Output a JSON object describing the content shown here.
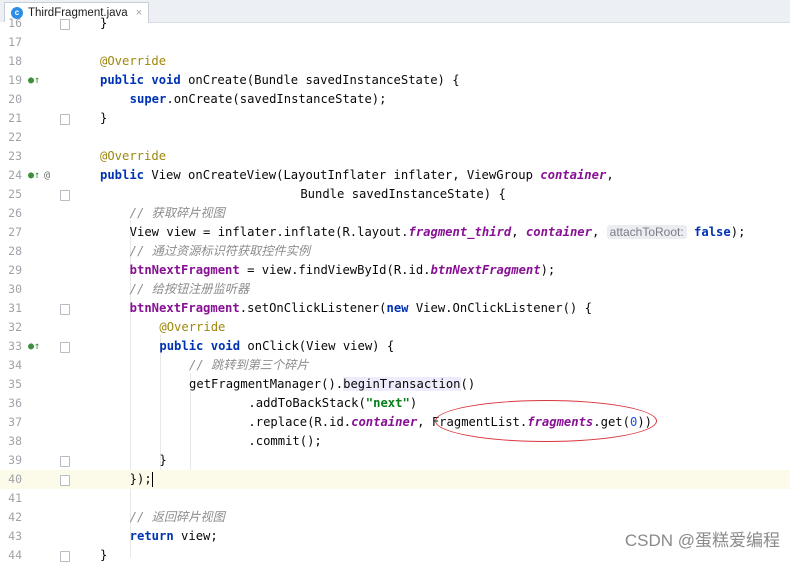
{
  "tab": {
    "label": "ThirdFragment.java",
    "close": "×"
  },
  "lines": [
    {
      "n": "16",
      "text": "}"
    },
    {
      "n": "17",
      "text": ""
    },
    {
      "n": "18",
      "text": "@Override"
    },
    {
      "n": "19",
      "text": "public void onCreate(Bundle savedInstanceState) {"
    },
    {
      "n": "20",
      "text": "super.onCreate(savedInstanceState);"
    },
    {
      "n": "21",
      "text": "}"
    },
    {
      "n": "22",
      "text": ""
    },
    {
      "n": "23",
      "text": "@Override"
    },
    {
      "n": "24",
      "text": "public View onCreateView(LayoutInflater inflater, ViewGroup container,"
    },
    {
      "n": "25",
      "text": "Bundle savedInstanceState) {"
    },
    {
      "n": "26",
      "text": "// 获取碎片视图"
    },
    {
      "n": "27",
      "text": "View view = inflater.inflate(R.layout.fragment_third, container, attachToRoot: false);"
    },
    {
      "n": "28",
      "text": "// 通过资源标识符获取控件实例"
    },
    {
      "n": "29",
      "text": "btnNextFragment = view.findViewById(R.id.btnNextFragment);"
    },
    {
      "n": "30",
      "text": "// 给按钮注册监听器"
    },
    {
      "n": "31",
      "text": "btnNextFragment.setOnClickListener(new View.OnClickListener() {"
    },
    {
      "n": "32",
      "text": "@Override"
    },
    {
      "n": "33",
      "text": "public void onClick(View view) {"
    },
    {
      "n": "34",
      "text": "// 跳转到第三个碎片"
    },
    {
      "n": "35",
      "text": "getFragmentManager().beginTransaction()"
    },
    {
      "n": "36",
      "text": ".addToBackStack(\"next\")"
    },
    {
      "n": "37",
      "text": ".replace(R.id.container, FragmentList.fragments.get(0))"
    },
    {
      "n": "38",
      "text": ".commit();"
    },
    {
      "n": "39",
      "text": "}"
    },
    {
      "n": "40",
      "text": "});"
    },
    {
      "n": "41",
      "text": ""
    },
    {
      "n": "42",
      "text": "// 返回碎片视图"
    },
    {
      "n": "43",
      "text": "return view;"
    },
    {
      "n": "44",
      "text": "}"
    }
  ],
  "hint": {
    "label": "attachToRoot:"
  },
  "watermark": "CSDN @蛋糕爱编程",
  "colors": {
    "keyword": "#0033b3",
    "annotation": "#9e880d",
    "comment": "#8c8c8c",
    "field": "#871094",
    "string": "#067d17",
    "number": "#1750eb",
    "highlight": "#fcfae8",
    "circle": "#d9363e"
  }
}
